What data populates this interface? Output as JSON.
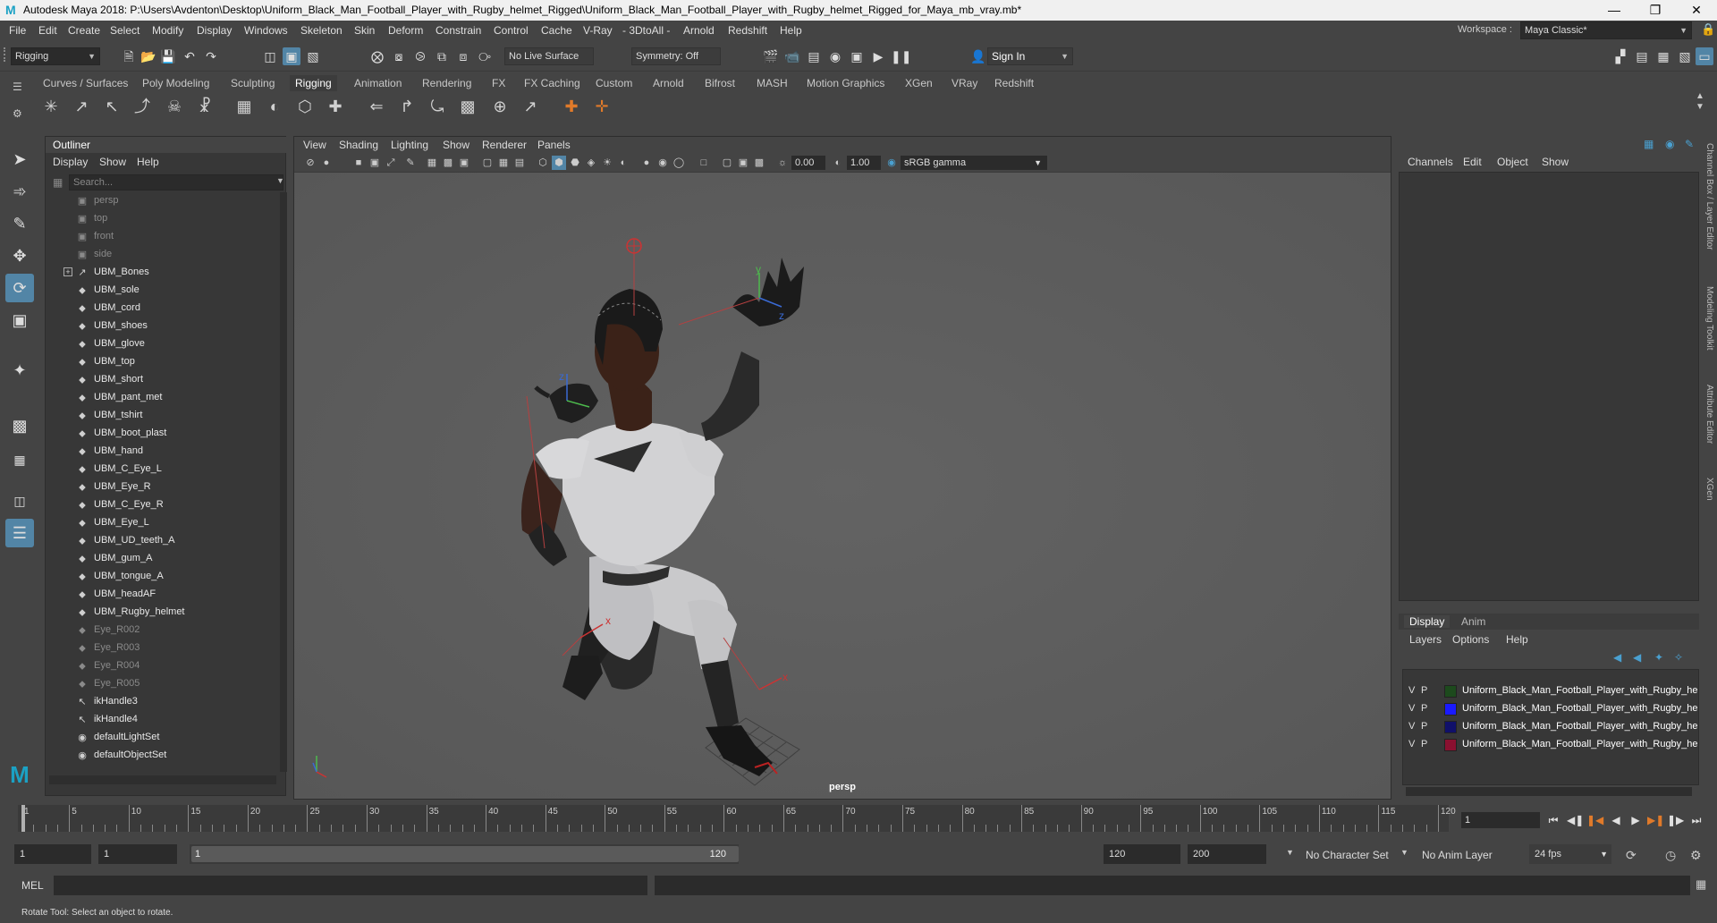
{
  "window": {
    "title": "Autodesk Maya 2018: P:\\Users\\Avdenton\\Desktop\\Uniform_Black_Man_Football_Player_with_Rugby_helmet_Rigged\\Uniform_Black_Man_Football_Player_with_Rugby_helmet_Rigged_for_Maya_mb_vray.mb*",
    "logo": "M"
  },
  "menubar": [
    "File",
    "Edit",
    "Create",
    "Select",
    "Modify",
    "Display",
    "Windows",
    "Skeleton",
    "Skin",
    "Deform",
    "Constrain",
    "Control",
    "Cache",
    "V-Ray",
    "- 3DtoAll -",
    "Arnold",
    "Redshift",
    "Help"
  ],
  "workspace": {
    "label": "Workspace :",
    "value": "Maya Classic*"
  },
  "statusline": {
    "menuset": "Rigging",
    "live_surface": "No Live Surface",
    "symmetry": "Symmetry: Off",
    "signin": "Sign In"
  },
  "shelf_tabs": [
    "Curves / Surfaces",
    "Poly Modeling",
    "Sculpting",
    "Rigging",
    "Animation",
    "Rendering",
    "FX",
    "FX Caching",
    "Custom",
    "Arnold",
    "Bifrost",
    "MASH",
    "Motion Graphics",
    "XGen",
    "VRay",
    "Redshift"
  ],
  "active_shelf_tab": "Rigging",
  "outliner": {
    "title": "Outliner",
    "menu": [
      "Display",
      "Show",
      "Help"
    ],
    "search_placeholder": "Search...",
    "items": [
      {
        "label": "persp",
        "icon": "camera-icon",
        "dim": true
      },
      {
        "label": "top",
        "icon": "camera-icon",
        "dim": true
      },
      {
        "label": "front",
        "icon": "camera-icon",
        "dim": true
      },
      {
        "label": "side",
        "icon": "camera-icon",
        "dim": true
      },
      {
        "label": "UBM_Bones",
        "icon": "joint-icon",
        "dim": false,
        "expandable": true
      },
      {
        "label": "UBM_sole",
        "icon": "mesh-icon",
        "dim": false
      },
      {
        "label": "UBM_cord",
        "icon": "mesh-icon",
        "dim": false
      },
      {
        "label": "UBM_shoes",
        "icon": "mesh-icon",
        "dim": false
      },
      {
        "label": "UBM_glove",
        "icon": "mesh-icon",
        "dim": false
      },
      {
        "label": "UBM_top",
        "icon": "mesh-icon",
        "dim": false
      },
      {
        "label": "UBM_short",
        "icon": "mesh-icon",
        "dim": false
      },
      {
        "label": "UBM_pant_met",
        "icon": "mesh-icon",
        "dim": false
      },
      {
        "label": "UBM_tshirt",
        "icon": "mesh-icon",
        "dim": false
      },
      {
        "label": "UBM_boot_plast",
        "icon": "mesh-icon",
        "dim": false
      },
      {
        "label": "UBM_hand",
        "icon": "mesh-icon",
        "dim": false
      },
      {
        "label": "UBM_C_Eye_L",
        "icon": "mesh-icon",
        "dim": false
      },
      {
        "label": "UBM_Eye_R",
        "icon": "mesh-icon",
        "dim": false
      },
      {
        "label": "UBM_C_Eye_R",
        "icon": "mesh-icon",
        "dim": false
      },
      {
        "label": "UBM_Eye_L",
        "icon": "mesh-icon",
        "dim": false
      },
      {
        "label": "UBM_UD_teeth_A",
        "icon": "mesh-icon",
        "dim": false
      },
      {
        "label": "UBM_gum_A",
        "icon": "mesh-icon",
        "dim": false
      },
      {
        "label": "UBM_tongue_A",
        "icon": "mesh-icon",
        "dim": false
      },
      {
        "label": "UBM_headAF",
        "icon": "mesh-icon",
        "dim": false
      },
      {
        "label": "UBM_Rugby_helmet",
        "icon": "mesh-icon",
        "dim": false
      },
      {
        "label": "Eye_R002",
        "icon": "mesh-icon",
        "dim": true
      },
      {
        "label": "Eye_R003",
        "icon": "mesh-icon",
        "dim": true
      },
      {
        "label": "Eye_R004",
        "icon": "mesh-icon",
        "dim": true
      },
      {
        "label": "Eye_R005",
        "icon": "mesh-icon",
        "dim": true
      },
      {
        "label": "ikHandle3",
        "icon": "ik-handle-icon",
        "dim": false
      },
      {
        "label": "ikHandle4",
        "icon": "ik-handle-icon",
        "dim": false
      },
      {
        "label": "defaultLightSet",
        "icon": "set-icon",
        "dim": false
      },
      {
        "label": "defaultObjectSet",
        "icon": "set-icon",
        "dim": false
      }
    ]
  },
  "viewport": {
    "menu": [
      "View",
      "Shading",
      "Lighting",
      "Show",
      "Renderer",
      "Panels"
    ],
    "near_value": "0.00",
    "far_value": "1.00",
    "color_space": "sRGB gamma",
    "camera_label": "persp",
    "gizmo_labels": {
      "x": "x",
      "y": "y",
      "z": "z"
    }
  },
  "channelbox": {
    "menu": [
      "Channels",
      "Edit",
      "Object",
      "Show"
    ],
    "layer_tabs": [
      "Display",
      "Anim"
    ],
    "layer_menu": [
      "Layers",
      "Options",
      "Help"
    ],
    "layers": [
      {
        "v": "V",
        "p": "P",
        "color": "#1d4a1d",
        "name": "Uniform_Black_Man_Football_Player_with_Rugby_he"
      },
      {
        "v": "V",
        "p": "P",
        "color": "#1a1aff",
        "name": "Uniform_Black_Man_Football_Player_with_Rugby_he"
      },
      {
        "v": "V",
        "p": "P",
        "color": "#10106a",
        "name": "Uniform_Black_Man_Football_Player_with_Rugby_he"
      },
      {
        "v": "V",
        "p": "P",
        "color": "#8a1030",
        "name": "Uniform_Black_Man_Football_Player_with_Rugby_he"
      }
    ],
    "side_tabs": [
      "Channel Box / Layer Editor",
      "Modeling Toolkit",
      "Attribute Editor",
      "XGen"
    ]
  },
  "timeslider": {
    "labels": [
      "1",
      "5",
      "10",
      "15",
      "20",
      "25",
      "30",
      "35",
      "40",
      "45",
      "50",
      "55",
      "60",
      "65",
      "70",
      "75",
      "80",
      "85",
      "90",
      "95",
      "100",
      "105",
      "110",
      "115",
      "120"
    ],
    "current_frame": "1"
  },
  "rangeslider": {
    "start": "1",
    "playback_start": "1",
    "range_start": "1",
    "range_end": "120",
    "playback_end": "120",
    "end": "200",
    "character_set": "No Character Set",
    "anim_layer": "No Anim Layer",
    "fps": "24 fps"
  },
  "cmdline": {
    "label": "MEL"
  },
  "helpline": {
    "text": "Rotate Tool: Select an object to rotate."
  }
}
